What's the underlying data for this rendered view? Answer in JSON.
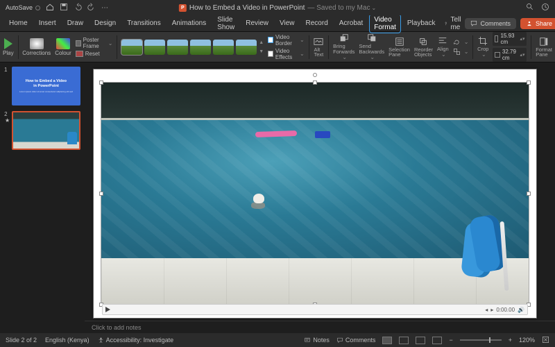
{
  "titlebar": {
    "autosave": "AutoSave",
    "doc_title": "How to Embed a Video in PowerPoint",
    "saved_status": "— Saved to my Mac",
    "pp_letter": "P"
  },
  "tabs": {
    "items": [
      "Home",
      "Insert",
      "Draw",
      "Design",
      "Transitions",
      "Animations",
      "Slide Show",
      "Review",
      "View",
      "Record",
      "Acrobat",
      "Video Format",
      "Playback"
    ],
    "active_index": 11,
    "tell_me": "Tell me",
    "comments": "Comments",
    "share": "Share"
  },
  "ribbon": {
    "play": "Play",
    "corrections": "Corrections",
    "colour": "Colour",
    "poster_frame": "Poster Frame",
    "reset": "Reset",
    "video_border": "Video Border",
    "video_effects": "Video Effects",
    "alt_text": "Alt\nText",
    "bring_forwards": "Bring\nForwards",
    "send_backwards": "Send\nBackwards",
    "selection_pane": "Selection\nPane",
    "reorder_objects": "Reorder\nObjects",
    "align": "Align",
    "crop": "Crop",
    "height_val": "15.93 cm",
    "width_val": "32.79 cm",
    "format_pane": "Format\nPane"
  },
  "thumbs": {
    "slide1_title": "How to Embed a Video\nin PowerPoint",
    "slide1_sub": "Lorem ipsum dolor sit amet consectetur adipiscing elit sed",
    "n1": "1",
    "n2": "2",
    "star": "★"
  },
  "video": {
    "time": "0:00.00"
  },
  "notes": {
    "placeholder": "Click to add notes"
  },
  "status": {
    "slide": "Slide 2 of 2",
    "language": "English (Kenya)",
    "accessibility": "Accessibility: Investigate",
    "notes": "Notes",
    "comments": "Comments",
    "zoom": "120%",
    "minus": "−",
    "plus": "+"
  }
}
